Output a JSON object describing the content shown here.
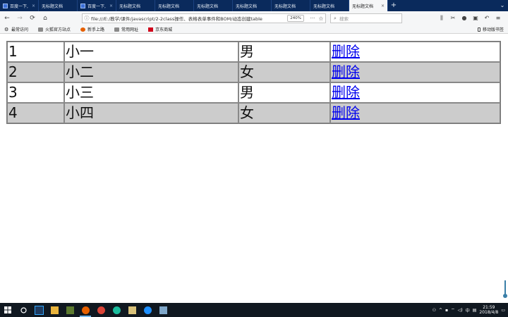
{
  "tabs": [
    {
      "title": "百度一下,",
      "active": false
    },
    {
      "title": "无标题文档",
      "active": false
    },
    {
      "title": "百度一下,",
      "active": false
    },
    {
      "title": "无标题文档",
      "active": false
    },
    {
      "title": "无标题文档",
      "active": false
    },
    {
      "title": "无标题文档",
      "active": false
    },
    {
      "title": "无标题文档",
      "active": false
    },
    {
      "title": "无标题文档",
      "active": false
    },
    {
      "title": "无标题文档",
      "active": false
    },
    {
      "title": "无标题文档",
      "active": true
    }
  ],
  "toolbar": {
    "url": "file:///E:/教学/课件/javascript/2-2class操作、表格表单事件和BOM/动态创建table",
    "zoom": "240%",
    "search_placeholder": "搜索"
  },
  "bookmarks": {
    "items": [
      "最常访问",
      "火狐官方站点",
      "新手上路",
      "常用网址",
      "京东商城"
    ],
    "mobile": "移动版书签"
  },
  "table": {
    "rows": [
      {
        "id": "1",
        "name": "小一",
        "gender": "男",
        "action": "删除"
      },
      {
        "id": "2",
        "name": "小二",
        "gender": "女",
        "action": "删除"
      },
      {
        "id": "3",
        "name": "小三",
        "gender": "男",
        "action": "删除"
      },
      {
        "id": "4",
        "name": "小四",
        "gender": "女",
        "action": "删除"
      }
    ],
    "stripe_color": "#cccccc"
  },
  "taskbar": {
    "time": "21:59",
    "date": "2018/4/8",
    "ime": "中"
  }
}
